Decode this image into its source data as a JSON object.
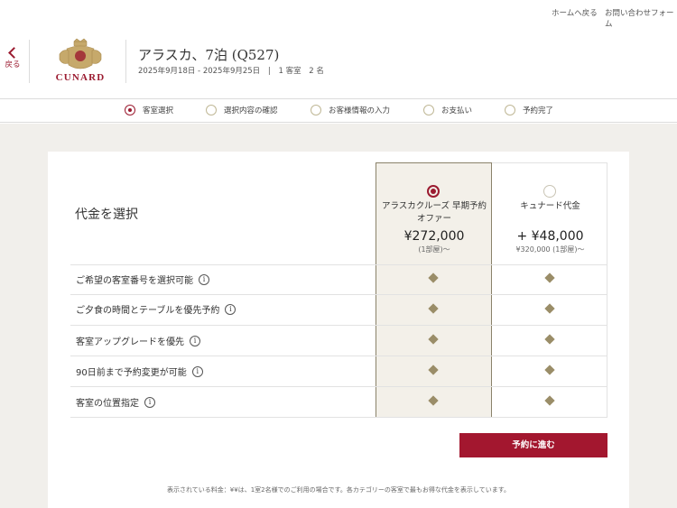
{
  "top_nav": {
    "home_link": "ホームへ戻る",
    "contact_link": "お問い合わせフォーム"
  },
  "header": {
    "back_label": "戻る",
    "logo_text": "CUNARD",
    "cruise_title": "アラスカ、7泊 (Q527)",
    "dates": "2025年9月18日 - 2025年9月25日",
    "separator": "|",
    "cabins": "1 客室",
    "guests": "2 名"
  },
  "steps": [
    {
      "label": "客室選択",
      "active": true
    },
    {
      "label": "選択内容の確認",
      "active": false
    },
    {
      "label": "お客様情報の入力",
      "active": false
    },
    {
      "label": "お支払い",
      "active": false
    },
    {
      "label": "予約完了",
      "active": false
    }
  ],
  "fare_selection": {
    "title": "代金を選択",
    "fares": [
      {
        "name_line1": "アラスカクルーズ 早期予約",
        "name_line2": "オファー",
        "price": "¥272,000",
        "note": "(1部屋)～",
        "selected": true
      },
      {
        "name_line1": "キュナード代金",
        "name_line2": "",
        "price": "+ ¥48,000",
        "note": "¥320,000 (1部屋)～",
        "selected": false
      }
    ],
    "features": [
      {
        "label": "ご希望の客室番号を選択可能",
        "info_icon": "i",
        "fare1": true,
        "fare2": true
      },
      {
        "label": "ご夕食の時間とテーブルを優先予約",
        "info_icon": "i",
        "fare1": true,
        "fare2": true
      },
      {
        "label": "客室アップグレードを優先",
        "info_icon": "i",
        "fare1": true,
        "fare2": true
      },
      {
        "label": "90日前まで予約変更が可能",
        "info_icon": "i",
        "fare1": true,
        "fare2": true
      },
      {
        "label": "客室の位置指定",
        "info_icon": "i",
        "fare1": true,
        "fare2": true
      }
    ]
  },
  "cta": {
    "label": "予約に進む"
  },
  "disclaimer": "表示されている料金：¥¥は、1室2名様でのご利用の場合です。各カテゴリーの客室で最もお得な代金を表示しています。",
  "colors": {
    "brand": "#a3172f",
    "gold": "#9a8d68",
    "selected_bg": "#f3f0e9"
  },
  "icons": {
    "back": "chevron-left-icon",
    "info": "info-icon",
    "included": "diamond-icon",
    "radio": "radio-icon"
  }
}
